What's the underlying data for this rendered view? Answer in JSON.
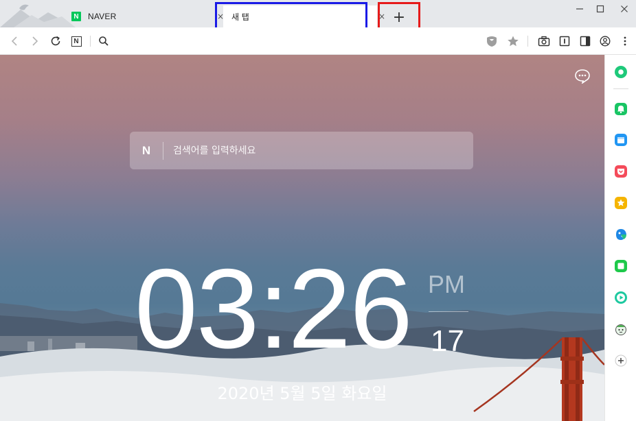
{
  "window": {
    "controls": {
      "minimize": "—",
      "maximize": "☐",
      "close": "✕"
    }
  },
  "tabs": [
    {
      "favicon": "N",
      "label": "NAVER",
      "close": "×",
      "active": false
    },
    {
      "label": "새 탭",
      "close": "×",
      "active": true
    }
  ],
  "new_tab_button": "+",
  "toolbar": {
    "site_icon": "N",
    "icons": [
      "back-icon",
      "forward-icon",
      "reload-icon",
      "naver-home-icon",
      "search-icon",
      "shield-icon",
      "bookmark-star-icon",
      "capture-camera-icon",
      "reader-icon",
      "sidebar-toggle-icon",
      "profile-icon",
      "menu-icon"
    ]
  },
  "newtab_page": {
    "search_logo": "N",
    "search_placeholder": "검색어를 입력하세요",
    "clock_time": "03:26",
    "ampm": "PM",
    "seconds": "17",
    "date": "2020년 5월 5일 화요일"
  },
  "sidebar": {
    "items": [
      {
        "icon": "green-circle-icon",
        "color": "#1ec97a"
      },
      {
        "icon": "bell-icon",
        "color": "#19c564"
      },
      {
        "icon": "calendar-icon",
        "color": "#2196f3"
      },
      {
        "icon": "pocket-icon",
        "color": "#f44b5a"
      },
      {
        "icon": "star-icon",
        "color": "#f5b400"
      },
      {
        "icon": "translate-icon",
        "color": "#1e88e5"
      },
      {
        "icon": "square-icon",
        "color": "#1ec94a"
      },
      {
        "icon": "play-icon",
        "color": "#1ec9a0"
      },
      {
        "icon": "mascot-icon",
        "color": "#4caf50"
      },
      {
        "icon": "add-icon",
        "color": "#555555"
      }
    ]
  },
  "colors": {
    "highlight_newtab": "#1a1ae6",
    "highlight_plus": "#e61a1a",
    "naver_green": "#03c75a"
  }
}
